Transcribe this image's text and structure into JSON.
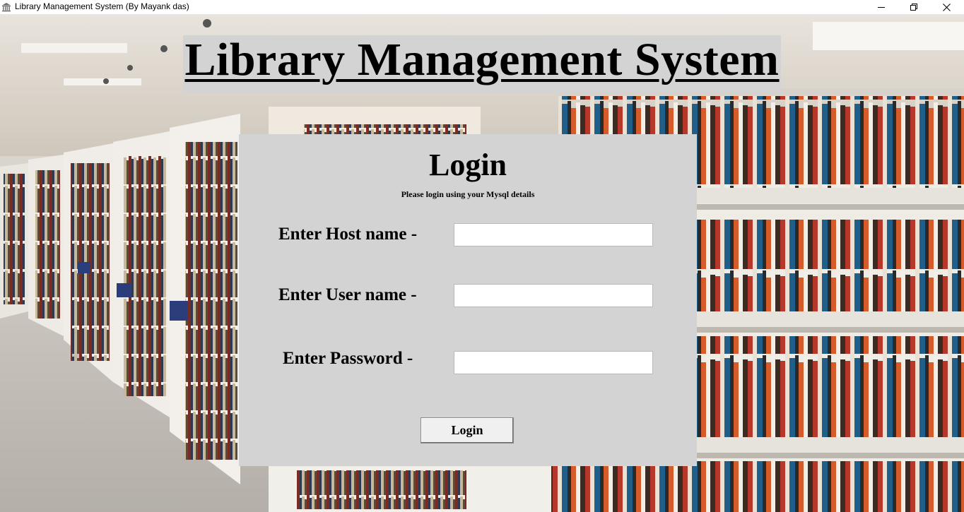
{
  "window": {
    "title": "Library Management System (By Mayank das)",
    "icon": "library-building-icon"
  },
  "banner": {
    "title": "Library Management System"
  },
  "login": {
    "heading": "Login",
    "subtitle": "Please login using your Mysql details",
    "host_label": "Enter Host name -",
    "host_value": "",
    "user_label": "Enter User name -",
    "user_value": "",
    "password_label": "Enter Password -",
    "password_value": "",
    "button_label": "Login"
  },
  "colors": {
    "panel_bg": "#d3d3d3",
    "text": "#000000"
  }
}
